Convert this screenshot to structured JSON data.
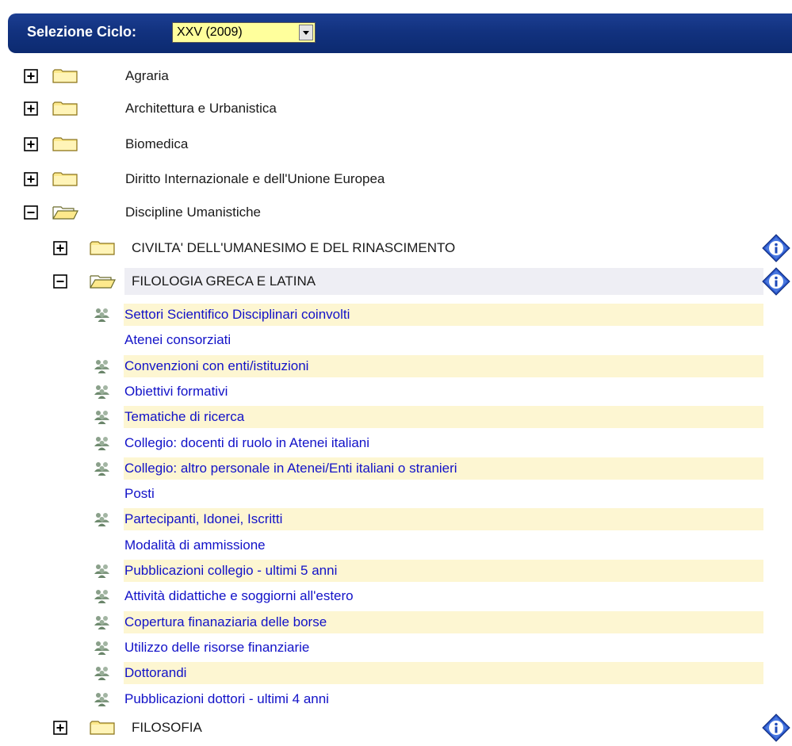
{
  "header": {
    "label": "Selezione Ciclo:",
    "cycle_value": "XXV (2009)"
  },
  "categories": [
    {
      "label": "Agraria",
      "expanded": false
    },
    {
      "label": "Architettura e Urbanistica",
      "expanded": false
    },
    {
      "label": "Biomedica",
      "expanded": false
    },
    {
      "label": "Diritto Internazionale e dell'Unione Europea",
      "expanded": false
    },
    {
      "label": "Discipline Umanistiche",
      "expanded": true
    }
  ],
  "subcategories": [
    {
      "label": "CIVILTA' DELL'UMANESIMO E DEL RINASCIMENTO",
      "expanded": false
    },
    {
      "label": "FILOLOGIA GRECA E LATINA",
      "expanded": true
    },
    {
      "label": "FILOSOFIA",
      "expanded": false
    }
  ],
  "items": [
    {
      "label": "Settori Scientifico Disciplinari coinvolti",
      "icon": true
    },
    {
      "label": "Atenei consorziati",
      "icon": false
    },
    {
      "label": "Convenzioni con enti/istituzioni",
      "icon": true
    },
    {
      "label": "Obiettivi formativi",
      "icon": true
    },
    {
      "label": "Tematiche di ricerca",
      "icon": true
    },
    {
      "label": "Collegio: docenti di ruolo in Atenei italiani",
      "icon": true
    },
    {
      "label": "Collegio: altro personale in Atenei/Enti italiani o stranieri",
      "icon": true
    },
    {
      "label": "Posti",
      "icon": false
    },
    {
      "label": "Partecipanti, Idonei, Iscritti",
      "icon": true
    },
    {
      "label": "Modalità di ammissione",
      "icon": false
    },
    {
      "label": "Pubblicazioni collegio - ultimi 5 anni",
      "icon": true
    },
    {
      "label": "Attività didattiche e soggiorni all'estero",
      "icon": true
    },
    {
      "label": "Copertura finanaziaria delle borse",
      "icon": true
    },
    {
      "label": "Utilizzo delle risorse finanziarie",
      "icon": true
    },
    {
      "label": "Dottorandi",
      "icon": true
    },
    {
      "label": "Pubblicazioni dottori - ultimi 4 anni",
      "icon": true
    }
  ],
  "icons": {
    "expand": "plus-box-icon",
    "collapse": "minus-box-icon",
    "folder_closed": "folder-icon",
    "folder_open": "folder-open-icon",
    "info": "info-icon",
    "item": "people-icon"
  },
  "colors": {
    "header_bg": "#12327f",
    "select_bg": "#ffff9c",
    "link": "#1212c8",
    "stripe": "#fdf6d2",
    "highlight": "#eeeef4"
  }
}
